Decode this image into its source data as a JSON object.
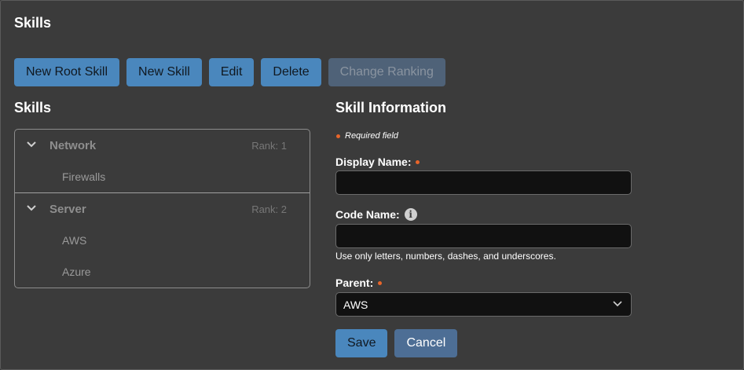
{
  "page": {
    "title": "Skills"
  },
  "toolbar": {
    "new_root_skill": "New Root Skill",
    "new_skill": "New Skill",
    "edit": "Edit",
    "delete": "Delete",
    "change_ranking": "Change Ranking"
  },
  "skills_panel": {
    "title": "Skills",
    "groups": [
      {
        "label": "Network",
        "rank": "Rank: 1",
        "children": [
          "Firewalls"
        ]
      },
      {
        "label": "Server",
        "rank": "Rank: 2",
        "children": [
          "AWS",
          "Azure"
        ]
      }
    ]
  },
  "info_panel": {
    "title": "Skill Information",
    "required_note": "Required field",
    "display_name": {
      "label": "Display Name:",
      "value": ""
    },
    "code_name": {
      "label": "Code Name:",
      "value": "",
      "helper": "Use only letters, numbers, dashes, and underscores."
    },
    "parent": {
      "label": "Parent:",
      "selected": "AWS"
    },
    "save": "Save",
    "cancel": "Cancel"
  },
  "colors": {
    "accent": "#4a87bd",
    "required_dot": "#e8652a",
    "background": "#3b3b3b"
  }
}
